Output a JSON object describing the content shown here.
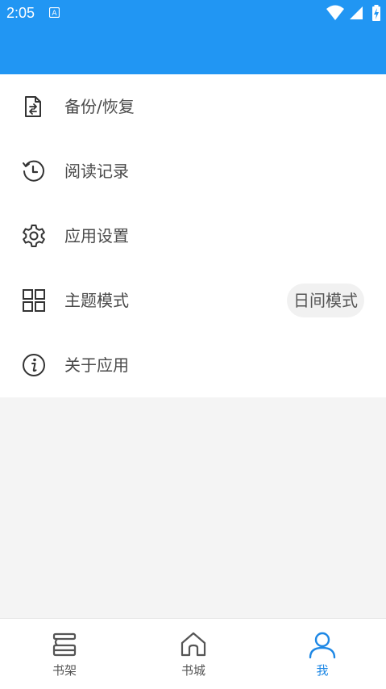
{
  "status_bar": {
    "time": "2:05",
    "icons": [
      "notification-a-icon",
      "wifi-icon",
      "signal-icon",
      "battery-charging-icon"
    ]
  },
  "header": {
    "color": "#2196f3"
  },
  "menu": {
    "items": [
      {
        "label": "备份/恢复",
        "icon": "backup-restore-icon"
      },
      {
        "label": "阅读记录",
        "icon": "history-icon"
      },
      {
        "label": "应用设置",
        "icon": "gear-icon"
      },
      {
        "label": "主题模式",
        "icon": "grid-icon",
        "value": "日间模式"
      },
      {
        "label": "关于应用",
        "icon": "info-icon"
      }
    ]
  },
  "bottom_nav": {
    "tabs": [
      {
        "label": "书架",
        "icon": "bookshelf-icon",
        "active": false
      },
      {
        "label": "书城",
        "icon": "home-icon",
        "active": false
      },
      {
        "label": "我",
        "icon": "person-icon",
        "active": true
      }
    ],
    "active_color": "#1e88e5"
  }
}
